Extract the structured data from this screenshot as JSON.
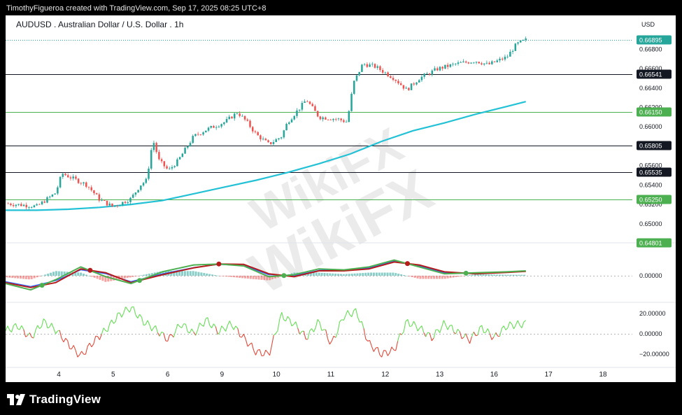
{
  "credit": "TimothyFigueroa created with TradingView.com, Sep 17, 2025 08:25 UTC+8",
  "symbol_title": "AUDUSD . Australian Dollar / U.S. Dollar . 1h",
  "currency": "USD",
  "footer_brand": "TradingView",
  "watermark": "WikiFX",
  "colors": {
    "up": "#26a69a",
    "down": "#ef5350",
    "ma_line": "#22c1d6",
    "green_level": "#4caf50",
    "black_level": "#131722",
    "macd_line": "#4caf50",
    "signal_line": "#b71c1c",
    "macd_blue": "#2962ff",
    "osc_up": "#66dd55",
    "osc_down": "#e04a3a"
  },
  "chart_data": [
    {
      "type": "candlestick",
      "title": "AUDUSD . Australian Dollar / U.S. Dollar . 1h",
      "xlabel": "",
      "ylabel": "USD",
      "x_ticks": [
        "4",
        "5",
        "6",
        "9",
        "10",
        "11",
        "12",
        "13",
        "16",
        "17",
        "18"
      ],
      "y_ticks": [
        "0.66800",
        "0.66600",
        "0.66400",
        "0.66200",
        "0.66000",
        "0.65600",
        "0.65400",
        "0.65200",
        "0.65000"
      ],
      "ylim": [
        0.6484,
        0.6699
      ],
      "last_price": "0.66895",
      "price_path": [
        [
          0,
          0.6521
        ],
        [
          0.05,
          0.6518
        ],
        [
          0.08,
          0.6532
        ],
        [
          0.09,
          0.6552
        ],
        [
          0.11,
          0.6546
        ],
        [
          0.13,
          0.654
        ],
        [
          0.15,
          0.6525
        ],
        [
          0.17,
          0.6518
        ],
        [
          0.18,
          0.652
        ],
        [
          0.2,
          0.6526
        ],
        [
          0.215,
          0.654
        ],
        [
          0.225,
          0.6545
        ],
        [
          0.235,
          0.6587
        ],
        [
          0.245,
          0.6565
        ],
        [
          0.26,
          0.6555
        ],
        [
          0.275,
          0.6565
        ],
        [
          0.3,
          0.659
        ],
        [
          0.32,
          0.6597
        ],
        [
          0.35,
          0.6605
        ],
        [
          0.37,
          0.6615
        ],
        [
          0.385,
          0.6605
        ],
        [
          0.4,
          0.6592
        ],
        [
          0.42,
          0.6582
        ],
        [
          0.44,
          0.659
        ],
        [
          0.45,
          0.6605
        ],
        [
          0.47,
          0.662
        ],
        [
          0.48,
          0.6628
        ],
        [
          0.5,
          0.661
        ],
        [
          0.53,
          0.6608
        ],
        [
          0.545,
          0.6605
        ],
        [
          0.555,
          0.6645
        ],
        [
          0.57,
          0.6665
        ],
        [
          0.59,
          0.6662
        ],
        [
          0.62,
          0.665
        ],
        [
          0.64,
          0.6638
        ],
        [
          0.66,
          0.665
        ],
        [
          0.69,
          0.666
        ],
        [
          0.72,
          0.6665
        ],
        [
          0.75,
          0.6668
        ],
        [
          0.77,
          0.6664
        ],
        [
          0.8,
          0.6672
        ],
        [
          0.815,
          0.6685
        ],
        [
          0.83,
          0.66895
        ]
      ],
      "ma_path": [
        [
          0,
          0.6514
        ],
        [
          0.05,
          0.6514
        ],
        [
          0.1,
          0.6515
        ],
        [
          0.15,
          0.6517
        ],
        [
          0.2,
          0.652
        ],
        [
          0.25,
          0.6524
        ],
        [
          0.3,
          0.6531
        ],
        [
          0.35,
          0.6538
        ],
        [
          0.4,
          0.6545
        ],
        [
          0.45,
          0.6553
        ],
        [
          0.5,
          0.6562
        ],
        [
          0.55,
          0.6572
        ],
        [
          0.6,
          0.6585
        ],
        [
          0.65,
          0.6596
        ],
        [
          0.7,
          0.6604
        ],
        [
          0.75,
          0.6613
        ],
        [
          0.8,
          0.6621
        ],
        [
          0.83,
          0.6626
        ]
      ],
      "levels": [
        {
          "label": "0.66895",
          "kind": "price"
        },
        {
          "label": "0.66541",
          "kind": "black"
        },
        {
          "label": "0.66150",
          "kind": "green"
        },
        {
          "label": "0.65805",
          "kind": "black"
        },
        {
          "label": "0.65535",
          "kind": "black"
        },
        {
          "label": "0.65250",
          "kind": "green"
        },
        {
          "label": "0.64801",
          "kind": "green_tag"
        }
      ]
    },
    {
      "type": "line",
      "title": "",
      "y_ticks": [
        "0.00000"
      ],
      "ylim": [
        -1,
        1
      ],
      "series": [
        {
          "values": [
            [
              0,
              -0.4
            ],
            [
              0.04,
              -0.72
            ],
            [
              0.08,
              -0.2
            ],
            [
              0.12,
              0.45
            ],
            [
              0.16,
              -0.05
            ],
            [
              0.2,
              -0.4
            ],
            [
              0.25,
              0.2
            ],
            [
              0.3,
              0.55
            ],
            [
              0.34,
              0.6
            ],
            [
              0.38,
              0.5
            ],
            [
              0.42,
              -0.05
            ],
            [
              0.46,
              0.05
            ],
            [
              0.5,
              0.35
            ],
            [
              0.54,
              0.3
            ],
            [
              0.58,
              0.45
            ],
            [
              0.62,
              0.8
            ],
            [
              0.66,
              0.45
            ],
            [
              0.7,
              0.1
            ],
            [
              0.75,
              0.15
            ],
            [
              0.8,
              0.2
            ],
            [
              0.83,
              0.25
            ]
          ]
        },
        {
          "values": [
            [
              0,
              -0.35
            ],
            [
              0.04,
              -0.6
            ],
            [
              0.08,
              -0.35
            ],
            [
              0.12,
              0.35
            ],
            [
              0.16,
              0.15
            ],
            [
              0.2,
              -0.35
            ],
            [
              0.25,
              0.05
            ],
            [
              0.3,
              0.4
            ],
            [
              0.34,
              0.6
            ],
            [
              0.38,
              0.58
            ],
            [
              0.42,
              0.1
            ],
            [
              0.46,
              -0.05
            ],
            [
              0.5,
              0.25
            ],
            [
              0.54,
              0.25
            ],
            [
              0.58,
              0.35
            ],
            [
              0.62,
              0.7
            ],
            [
              0.66,
              0.55
            ],
            [
              0.7,
              0.2
            ],
            [
              0.75,
              0.1
            ],
            [
              0.8,
              0.17
            ],
            [
              0.83,
              0.22
            ]
          ]
        },
        {
          "values": [
            [
              0,
              -0.3
            ],
            [
              0.04,
              -0.55
            ],
            [
              0.08,
              -0.25
            ],
            [
              0.12,
              0.3
            ],
            [
              0.16,
              0.1
            ],
            [
              0.2,
              -0.3
            ],
            [
              0.25,
              0.1
            ],
            [
              0.3,
              0.42
            ],
            [
              0.34,
              0.58
            ],
            [
              0.38,
              0.52
            ],
            [
              0.42,
              0.05
            ],
            [
              0.46,
              0.0
            ],
            [
              0.5,
              0.28
            ],
            [
              0.54,
              0.28
            ],
            [
              0.58,
              0.4
            ],
            [
              0.62,
              0.75
            ],
            [
              0.66,
              0.5
            ],
            [
              0.7,
              0.15
            ],
            [
              0.75,
              0.12
            ],
            [
              0.8,
              0.18
            ],
            [
              0.83,
              0.23
            ]
          ]
        }
      ]
    },
    {
      "type": "line",
      "title": "",
      "y_ticks": [
        "20.00000",
        "0.00000",
        "−20.00000"
      ],
      "ylim": [
        -30,
        30
      ],
      "series": [
        {
          "values": [
            [
              0,
              3
            ],
            [
              0.02,
              8
            ],
            [
              0.04,
              -4
            ],
            [
              0.06,
              12
            ],
            [
              0.08,
              4
            ],
            [
              0.1,
              -10
            ],
            [
              0.12,
              -22
            ],
            [
              0.14,
              -8
            ],
            [
              0.16,
              4
            ],
            [
              0.18,
              18
            ],
            [
              0.2,
              26
            ],
            [
              0.22,
              12
            ],
            [
              0.24,
              4
            ],
            [
              0.26,
              -6
            ],
            [
              0.28,
              10
            ],
            [
              0.3,
              0
            ],
            [
              0.32,
              14
            ],
            [
              0.34,
              2
            ],
            [
              0.36,
              10
            ],
            [
              0.38,
              -4
            ],
            [
              0.4,
              -18
            ],
            [
              0.42,
              -20
            ],
            [
              0.44,
              18
            ],
            [
              0.46,
              10
            ],
            [
              0.48,
              -4
            ],
            [
              0.5,
              12
            ],
            [
              0.52,
              -10
            ],
            [
              0.54,
              18
            ],
            [
              0.56,
              22
            ],
            [
              0.58,
              -10
            ],
            [
              0.6,
              -20
            ],
            [
              0.62,
              -16
            ],
            [
              0.64,
              12
            ],
            [
              0.66,
              6
            ],
            [
              0.68,
              -4
            ],
            [
              0.7,
              10
            ],
            [
              0.72,
              2
            ],
            [
              0.74,
              -6
            ],
            [
              0.76,
              6
            ],
            [
              0.78,
              -4
            ],
            [
              0.8,
              8
            ],
            [
              0.83,
              10
            ]
          ]
        }
      ]
    }
  ]
}
